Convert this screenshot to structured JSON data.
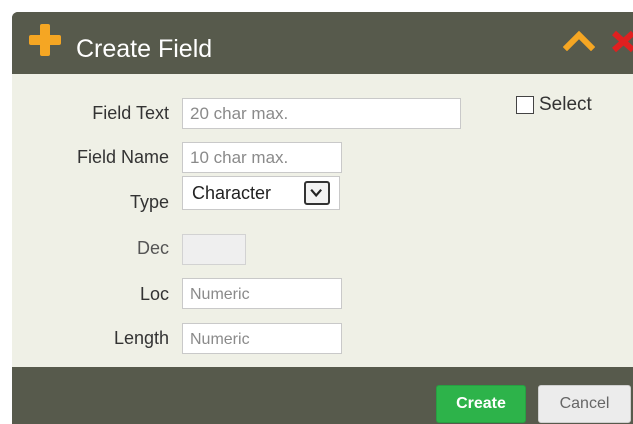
{
  "dialog": {
    "title": "Create Field",
    "icons": {
      "add": "plus-icon",
      "collapse": "chevron-up-icon",
      "close": "close-icon"
    },
    "colors": {
      "titlebar": "#575a4c",
      "body": "#eff0e6",
      "accent_orange": "#f5a623",
      "close_red": "#e02020",
      "create_green": "#2db34a"
    }
  },
  "form": {
    "field_text": {
      "label": "Field Text",
      "value": "",
      "placeholder": "20 char max."
    },
    "field_name": {
      "label": "Field Name",
      "value": "",
      "placeholder": "10 char max."
    },
    "type": {
      "label": "Type",
      "selected": "Character"
    },
    "dec": {
      "label": "Dec",
      "value": "",
      "placeholder": ""
    },
    "loc": {
      "label": "Loc",
      "value": "",
      "placeholder": "Numeric"
    },
    "length": {
      "label": "Length",
      "value": "",
      "placeholder": "Numeric"
    },
    "select": {
      "label": "Select",
      "checked": false
    }
  },
  "buttons": {
    "create": "Create",
    "cancel": "Cancel"
  }
}
